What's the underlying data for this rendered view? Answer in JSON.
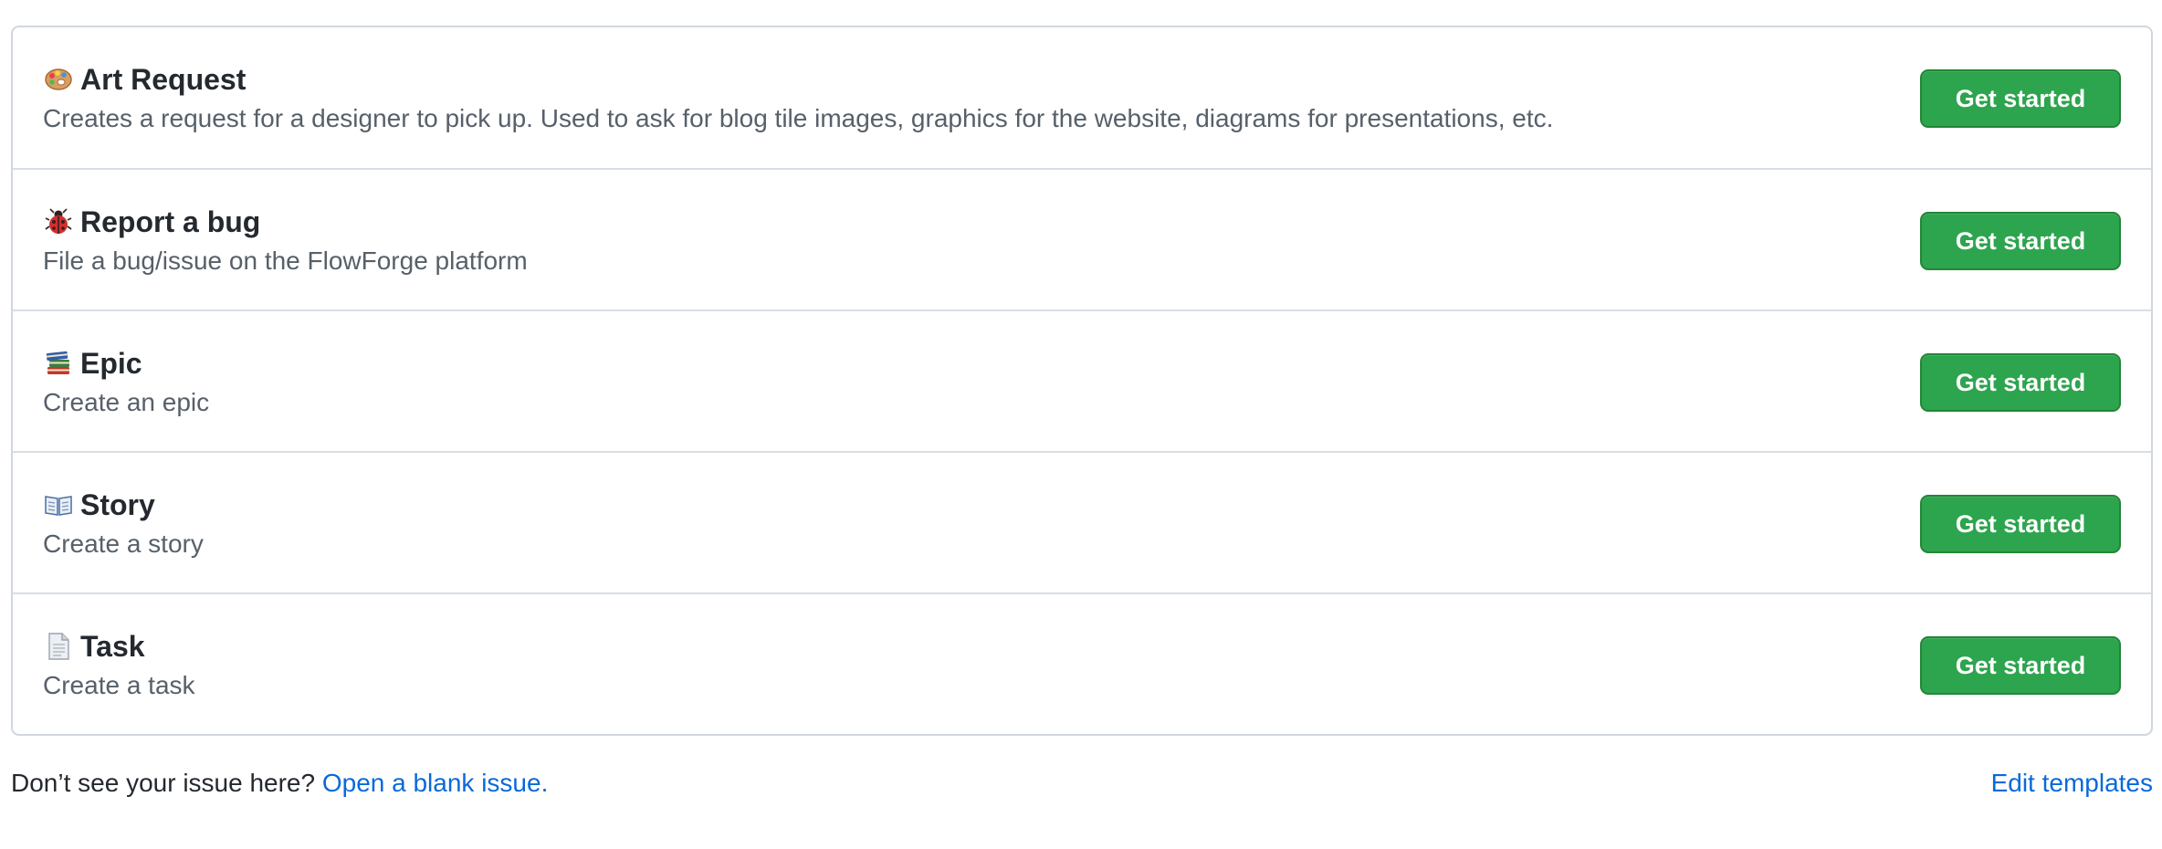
{
  "templates": [
    {
      "icon": "artist-palette-icon",
      "title": "Art Request",
      "description": "Creates a request for a designer to pick up. Used to ask for blog tile images, graphics for the website, diagrams for presentations, etc.",
      "button_label": "Get started"
    },
    {
      "icon": "lady-beetle-icon",
      "title": "Report a bug",
      "description": "File a bug/issue on the FlowForge platform",
      "button_label": "Get started"
    },
    {
      "icon": "books-icon",
      "title": "Epic",
      "description": "Create an epic",
      "button_label": "Get started"
    },
    {
      "icon": "open-book-icon",
      "title": "Story",
      "description": "Create a story",
      "button_label": "Get started"
    },
    {
      "icon": "page-facing-up-icon",
      "title": "Task",
      "description": "Create a task",
      "button_label": "Get started"
    }
  ],
  "footer": {
    "prompt_text": "Don’t see your issue here?",
    "blank_issue_link": "Open a blank issue.",
    "edit_templates_link": "Edit templates"
  },
  "colors": {
    "button_bg": "#2da44e",
    "button_border": "#238636",
    "link": "#0969da",
    "border": "#d0d7de",
    "description_text": "#57606a",
    "title_text": "#24292f"
  }
}
